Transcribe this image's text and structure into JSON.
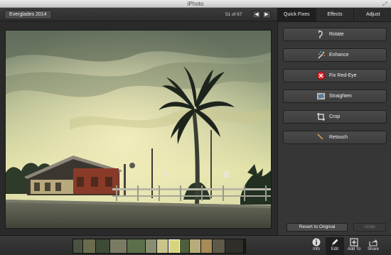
{
  "window": {
    "title": "iPhoto"
  },
  "photo_toolbar": {
    "album": "Everglades 2014",
    "counter": "51 of 67"
  },
  "panel": {
    "tabs": [
      {
        "label": "Quick Fixes",
        "active": true
      },
      {
        "label": "Effects",
        "active": false
      },
      {
        "label": "Adjust",
        "active": false
      }
    ],
    "fixes": [
      {
        "label": "Rotate",
        "icon": "rotate-icon"
      },
      {
        "label": "Enhance",
        "icon": "magic-wand-icon"
      },
      {
        "label": "Fix Red-Eye",
        "icon": "red-eye-icon"
      },
      {
        "label": "Straighten",
        "icon": "straighten-icon"
      },
      {
        "label": "Crop",
        "icon": "crop-icon"
      },
      {
        "label": "Retouch",
        "icon": "brush-icon"
      }
    ],
    "revert_label": "Revert to Original",
    "undo_label": "Undo"
  },
  "bottom_toolbar": {
    "info_label": "Info",
    "edit_label": "Edit",
    "add_label": "Add To",
    "share_label": "Share"
  },
  "colors": {
    "accent_red": "#d8262b",
    "panel_bg": "#363636",
    "toolbar_bg": "#2f2f2f"
  }
}
